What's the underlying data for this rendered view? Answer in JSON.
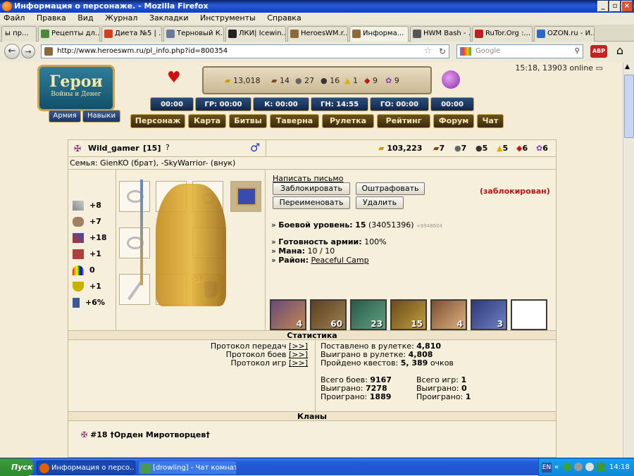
{
  "window": {
    "title": "Информация о персонаже. - Mozilla Firefox"
  },
  "menu": [
    "Файл",
    "Правка",
    "Вид",
    "Журнал",
    "Закладки",
    "Инструменты",
    "Справка"
  ],
  "tabs": [
    {
      "label": "ы пр..."
    },
    {
      "label": "Рецепты дл..."
    },
    {
      "label": "Диета №5 | ..."
    },
    {
      "label": "Терновый К..."
    },
    {
      "label": "ЛКИ| Icewin..."
    },
    {
      "label": "HeroesWM.r..."
    },
    {
      "label": "Информа..."
    },
    {
      "label": "HWM Bash - ..."
    },
    {
      "label": "RuTor.Org :..."
    },
    {
      "label": "OZON.ru - И..."
    }
  ],
  "nav": {
    "url": "http://www.heroeswm.ru/pl_info.php?id=800354",
    "search_placeholder": "Google"
  },
  "game": {
    "logo_title": "Герои",
    "logo_sub": "Войны и Денег",
    "clock": "15:18, 13903 online",
    "resources": {
      "gold": "13,018",
      "wood": "14",
      "ore": "27",
      "mercury": "16",
      "sulfur": "1",
      "crystals": "9",
      "gems": "9"
    },
    "timers": [
      "00:00",
      "ГР: 00:00",
      "К: 00:00",
      "ГН: 14:55",
      "ГО: 00:00",
      "00:00"
    ],
    "sub_buttons": [
      "Армия",
      "Навыки"
    ],
    "main_nav": [
      "Персонаж",
      "Карта",
      "Битвы",
      "Таверна",
      "Рулетка",
      "Рейтинг",
      "Форум",
      "Чат"
    ]
  },
  "player": {
    "name": "Wild_gamer",
    "level_badge": "[15]",
    "family": "Семья: GienKO (брат), -SkyWarrior- (внук)",
    "gold": "103,223",
    "res": {
      "wood": "7",
      "ore": "7",
      "mercury": "5",
      "sulfur": "5",
      "crystals": "6",
      "gems": "6"
    },
    "stats": [
      {
        "icon": "attack-icon",
        "value": "+8"
      },
      {
        "icon": "defense-icon",
        "value": "+7"
      },
      {
        "icon": "spell-power-icon",
        "value": "+18"
      },
      {
        "icon": "knowledge-icon",
        "value": "+1"
      },
      {
        "icon": "luck-icon",
        "value": "0"
      },
      {
        "icon": "morale-icon",
        "value": "+1"
      },
      {
        "icon": "initiative-icon",
        "value": "+6%"
      }
    ],
    "weapon_count": "57",
    "actions": {
      "write": "Написать письмо",
      "block": "Заблокировать",
      "fine": "Оштрафовать",
      "rename": "Переименовать",
      "delete": "Удалить",
      "blocked": "(заблокирован)"
    },
    "info": {
      "level_label": "Боевой уровень:",
      "level_value": "15",
      "exp": "(34051396)",
      "exp_extra": "+8948604",
      "army_label": "Готовность армии:",
      "army_value": "100%",
      "mana_label": "Мана:",
      "mana_value": "10 / 10",
      "district_label": "Район:",
      "district_value": "Peaceful Camp"
    },
    "army": [
      {
        "count": "4"
      },
      {
        "count": "60"
      },
      {
        "count": "23"
      },
      {
        "count": "15"
      },
      {
        "count": "4"
      },
      {
        "count": "3"
      },
      {
        "count": ""
      }
    ]
  },
  "stats_section": {
    "title": "Статистика",
    "protocols": [
      "Протокол передач",
      "Протокол боев",
      "Протокол игр"
    ],
    "protocol_link": "[>>]",
    "roulette_bet_label": "Поставлено в рулетке:",
    "roulette_bet": "4,810",
    "roulette_won_label": "Выиграно в рулетке:",
    "roulette_won": "4,808",
    "quests_label": "Пройдено квестов:",
    "quests": "5, 389",
    "quests_suffix": "очков",
    "battles_label": "Всего боев:",
    "battles": "9167",
    "battles_won_label": "Выиграно:",
    "battles_won": "7278",
    "battles_lost_label": "Проиграно:",
    "battles_lost": "1889",
    "games_label": "Всего игр:",
    "games": "1",
    "games_won_label": "Выиграно:",
    "games_won": "0",
    "games_lost_label": "Проиграно:",
    "games_lost": "1"
  },
  "clans": {
    "title": "Кланы",
    "entry": "#18 †Орден Миротворцев†"
  },
  "taskbar": {
    "start": "Пуск",
    "tasks": [
      "Информация о персо...",
      "[drowling] - Чат комнат..."
    ],
    "lang": "EN",
    "time": "14:18"
  }
}
